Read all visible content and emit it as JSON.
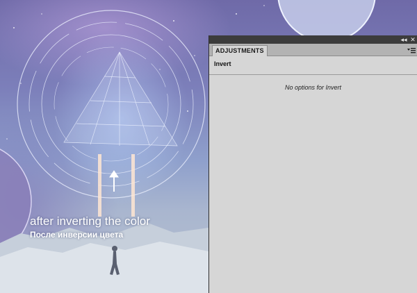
{
  "canvas": {
    "caption_en": "after inverting the color",
    "caption_ru": "После инверсии цвета"
  },
  "panel": {
    "tab_label": "ADJUSTMENTS",
    "title": "Invert",
    "message": "No options for Invert",
    "collapse_glyph": "◂◂",
    "close_glyph": "✕"
  },
  "colors": {
    "panel_bg": "#d6d6d6",
    "panel_topbar": "#3c3c3c",
    "tabbar_bg": "#b3b3b3",
    "caption_text": "#ffffff"
  },
  "icons": [
    "panel-menu-icon",
    "arrow-up-icon",
    "collapse-icon",
    "close-icon"
  ]
}
